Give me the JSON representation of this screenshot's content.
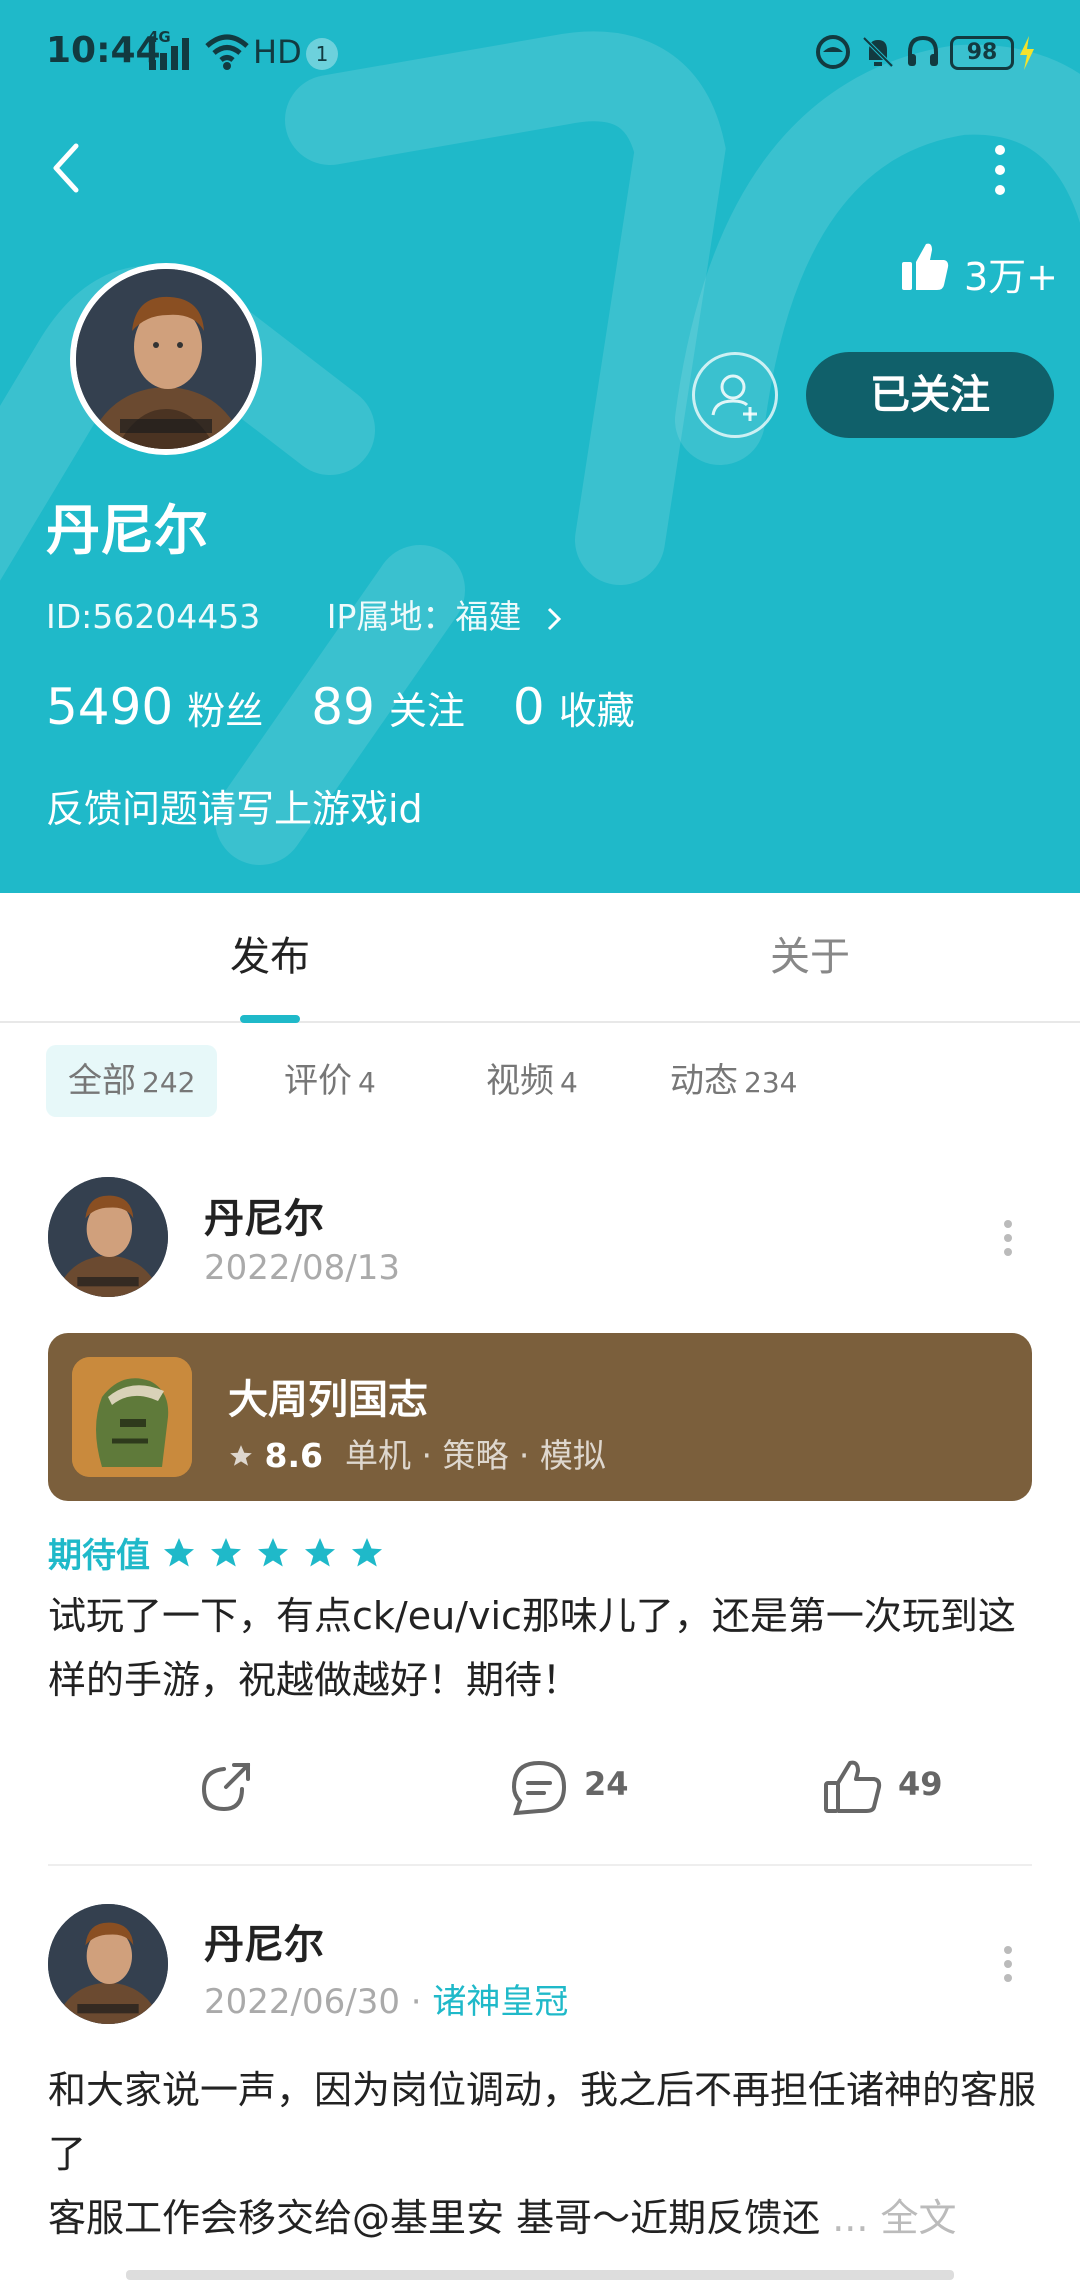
{
  "status_bar": {
    "time": "10:44",
    "network": "4G",
    "hd": "HD",
    "notif_count": "1",
    "battery": "98"
  },
  "header": {
    "like_total": "3万+",
    "follow_label": "已关注",
    "username": "丹尼尔",
    "id_text": "ID:56204453",
    "ip_text": "IP属地：福建",
    "stats": [
      {
        "num": "5490",
        "label": "粉丝"
      },
      {
        "num": "89",
        "label": "关注"
      },
      {
        "num": "0",
        "label": "收藏"
      }
    ],
    "bio": "反馈问题请写上游戏id",
    "bg_color": "#1fb9c9"
  },
  "tabs": [
    {
      "label": "发布",
      "active": true
    },
    {
      "label": "关于",
      "active": false
    }
  ],
  "filters": [
    {
      "label": "全部",
      "count": "242",
      "active": true
    },
    {
      "label": "评价",
      "count": "4",
      "active": false
    },
    {
      "label": "视频",
      "count": "4",
      "active": false
    },
    {
      "label": "动态",
      "count": "234",
      "active": false
    }
  ],
  "posts": [
    {
      "author": "丹尼尔",
      "date": "2022/08/13",
      "game": {
        "title": "大周列国志",
        "score": "8.6",
        "tags": "单机 · 策略 · 模拟",
        "card_color": "#7b5f3c"
      },
      "rating_label": "期待值",
      "rating": 5,
      "body": "试玩了一下，有点ck/eu/vic那味儿了，还是第一次玩到这样的手游，祝越做越好！期待！",
      "comments": "24",
      "likes": "49"
    },
    {
      "author": "丹尼尔",
      "date": "2022/06/30",
      "dot": "·",
      "game_link": "诸神皇冠",
      "body_line1": "和大家说一声，因为岗位调动，我之后不再担任诸神的客服了",
      "body_line2": "客服工作会移交给@基里安 基哥～近期反馈还",
      "ellipsis": "...",
      "more": "全文"
    }
  ],
  "icons": {
    "back": "chevron-left-icon",
    "more": "more-vertical-icon",
    "like": "thumb-up-icon",
    "add_friend": "add-user-icon",
    "share": "share-icon",
    "comment": "comment-icon",
    "star": "star-icon"
  },
  "accent_color": "#1fb9c9"
}
